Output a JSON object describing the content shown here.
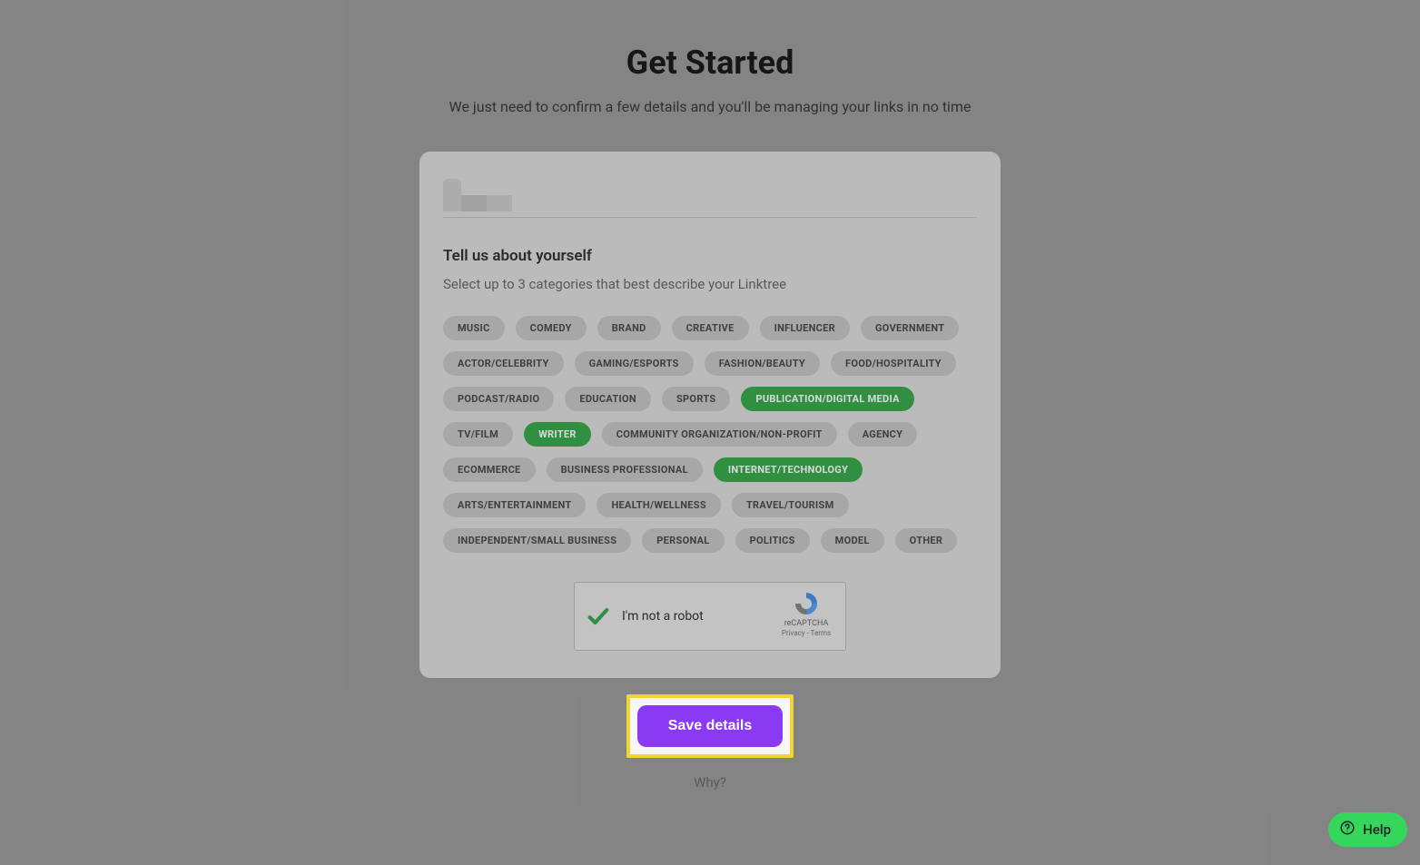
{
  "header": {
    "title": "Get Started",
    "subtitle": "We just need to confirm a few details and you'll be managing your links in no time"
  },
  "section": {
    "heading": "Tell us about yourself",
    "subheading": "Select up to 3 categories that best describe your Linktree"
  },
  "categories": [
    {
      "label": "MUSIC",
      "selected": false
    },
    {
      "label": "COMEDY",
      "selected": false
    },
    {
      "label": "BRAND",
      "selected": false
    },
    {
      "label": "CREATIVE",
      "selected": false
    },
    {
      "label": "INFLUENCER",
      "selected": false
    },
    {
      "label": "GOVERNMENT",
      "selected": false
    },
    {
      "label": "ACTOR/CELEBRITY",
      "selected": false
    },
    {
      "label": "GAMING/ESPORTS",
      "selected": false
    },
    {
      "label": "FASHION/BEAUTY",
      "selected": false
    },
    {
      "label": "FOOD/HOSPITALITY",
      "selected": false
    },
    {
      "label": "PODCAST/RADIO",
      "selected": false
    },
    {
      "label": "EDUCATION",
      "selected": false
    },
    {
      "label": "SPORTS",
      "selected": false
    },
    {
      "label": "PUBLICATION/DIGITAL MEDIA",
      "selected": true
    },
    {
      "label": "TV/FILM",
      "selected": false
    },
    {
      "label": "WRITER",
      "selected": true
    },
    {
      "label": "COMMUNITY ORGANIZATION/NON-PROFIT",
      "selected": false
    },
    {
      "label": "AGENCY",
      "selected": false
    },
    {
      "label": "ECOMMERCE",
      "selected": false
    },
    {
      "label": "BUSINESS PROFESSIONAL",
      "selected": false
    },
    {
      "label": "INTERNET/TECHNOLOGY",
      "selected": true
    },
    {
      "label": "ARTS/ENTERTAINMENT",
      "selected": false
    },
    {
      "label": "HEALTH/WELLNESS",
      "selected": false
    },
    {
      "label": "TRAVEL/TOURISM",
      "selected": false
    },
    {
      "label": "INDEPENDENT/SMALL BUSINESS",
      "selected": false
    },
    {
      "label": "PERSONAL",
      "selected": false
    },
    {
      "label": "POLITICS",
      "selected": false
    },
    {
      "label": "MODEL",
      "selected": false
    },
    {
      "label": "OTHER",
      "selected": false
    }
  ],
  "recaptcha": {
    "label": "I'm not a robot",
    "brand": "reCAPTCHA",
    "links": "Privacy - Terms",
    "checked": true
  },
  "actions": {
    "save": "Save details",
    "why": "Why?"
  },
  "help": {
    "label": "Help"
  },
  "colors": {
    "chip_selected_bg": "#3aa84e",
    "save_button_bg": "#8a3af2",
    "highlight_border": "#f2d433",
    "help_bg": "#34d65c"
  }
}
